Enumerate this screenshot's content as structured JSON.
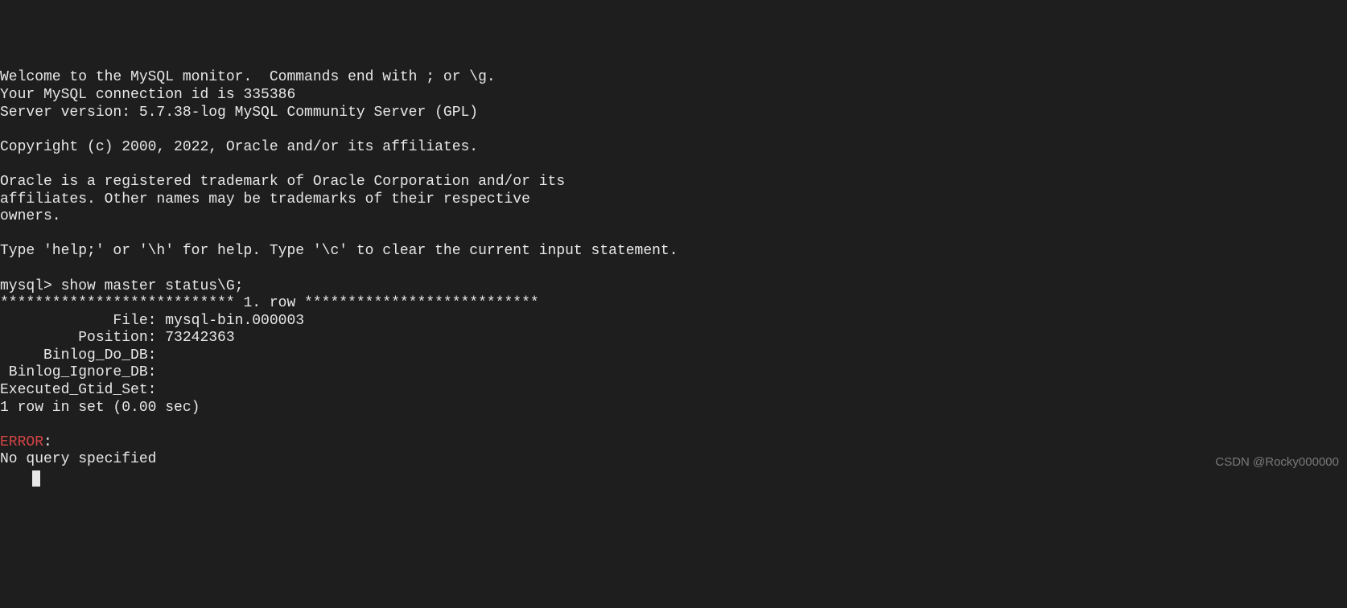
{
  "banner": {
    "welcome": "Welcome to the MySQL monitor.  Commands end with ; or \\g.",
    "conn_id_line": "Your MySQL connection id is 335386",
    "server_version": "Server version: 5.7.38-log MySQL Community Server (GPL)",
    "copyright": "Copyright (c) 2000, 2022, Oracle and/or its affiliates.",
    "trademark1": "Oracle is a registered trademark of Oracle Corporation and/or its",
    "trademark2": "affiliates. Other names may be trademarks of their respective",
    "trademark3": "owners.",
    "help": "Type 'help;' or '\\h' for help. Type '\\c' to clear the current input statement."
  },
  "prompt": "mysql> ",
  "command": "show master status\\G;",
  "row_sep": "*************************** 1. row ***************************",
  "result": {
    "file_label": "             File: ",
    "file_value": "mysql-bin.000003",
    "position_label": "         Position: ",
    "position_value": "73242363",
    "binlog_do_label": "     Binlog_Do_DB: ",
    "binlog_do_value": "",
    "binlog_ig_label": " Binlog_Ignore_DB: ",
    "binlog_ig_value": "",
    "gtid_label": "Executed_Gtid_Set: ",
    "gtid_value": ""
  },
  "footer": "1 row in set (0.00 sec)",
  "error_label": "ERROR",
  "error_colon": ": ",
  "error_msg": "No query specified",
  "watermark": "CSDN @Rocky000000"
}
